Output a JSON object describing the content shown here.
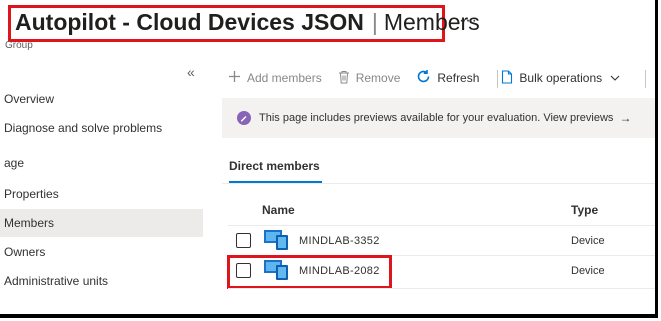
{
  "header": {
    "title_main": "Autopilot - Cloud Devices JSON",
    "title_sep": "|",
    "title_sub": "Members",
    "more_label": "···",
    "subtitle": "Group"
  },
  "sidebar": {
    "collapse_label": "«",
    "items": [
      {
        "label": "Overview"
      },
      {
        "label": "Diagnose and solve problems"
      }
    ],
    "section_label": "age",
    "manage_items": [
      {
        "label": "Properties",
        "selected": false
      },
      {
        "label": "Members",
        "selected": true
      },
      {
        "label": "Owners",
        "selected": false
      },
      {
        "label": "Administrative units",
        "selected": false
      }
    ]
  },
  "toolbar": {
    "add_label": "Add members",
    "remove_label": "Remove",
    "refresh_label": "Refresh",
    "bulk_label": "Bulk operations"
  },
  "banner": {
    "text": "This page includes previews available for your evaluation. View previews",
    "arrow": "→"
  },
  "tabs": {
    "direct_members": "Direct members"
  },
  "table": {
    "columns": {
      "name": "Name",
      "type": "Type"
    },
    "rows": [
      {
        "name": "MINDLAB-3352",
        "type": "Device",
        "highlighted": false
      },
      {
        "name": "MINDLAB-2082",
        "type": "Device",
        "highlighted": true
      }
    ]
  },
  "colors": {
    "accent": "#0078d4",
    "highlight_border": "#e0141b",
    "info_badge": "#8764b8"
  }
}
